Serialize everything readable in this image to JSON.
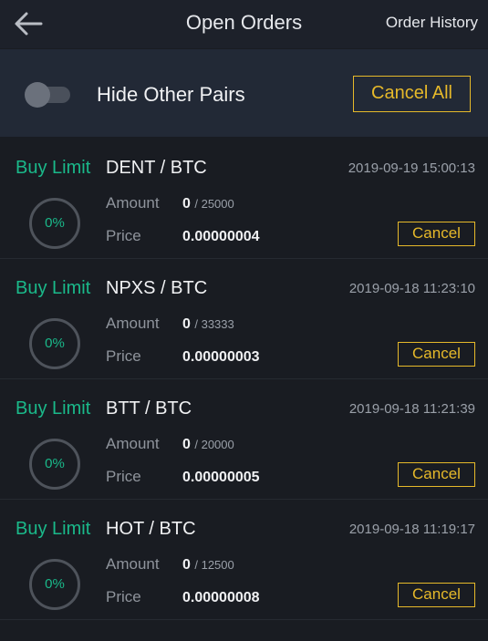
{
  "header": {
    "title": "Open Orders",
    "order_history_label": "Order History",
    "back_icon": "arrow-left-icon"
  },
  "filter": {
    "hide_other_pairs_label": "Hide Other Pairs",
    "hide_other_pairs_enabled": false,
    "cancel_all_label": "Cancel All"
  },
  "labels": {
    "amount": "Amount",
    "price": "Price",
    "cancel": "Cancel"
  },
  "orders": [
    {
      "type": "Buy Limit",
      "pair": "DENT / BTC",
      "time": "2019-09-19 15:00:13",
      "progress": "0%",
      "filled": "0",
      "total": "/ 25000",
      "price": "0.00000004"
    },
    {
      "type": "Buy Limit",
      "pair": "NPXS / BTC",
      "time": "2019-09-18 11:23:10",
      "progress": "0%",
      "filled": "0",
      "total": "/ 33333",
      "price": "0.00000003"
    },
    {
      "type": "Buy Limit",
      "pair": "BTT / BTC",
      "time": "2019-09-18 11:21:39",
      "progress": "0%",
      "filled": "0",
      "total": "/ 20000",
      "price": "0.00000005"
    },
    {
      "type": "Buy Limit",
      "pair": "HOT / BTC",
      "time": "2019-09-18 11:19:17",
      "progress": "0%",
      "filled": "0",
      "total": "/ 12500",
      "price": "0.00000008"
    }
  ],
  "colors": {
    "buy": "#1ab98a",
    "accent": "#e6b92a",
    "background": "#191c22"
  }
}
